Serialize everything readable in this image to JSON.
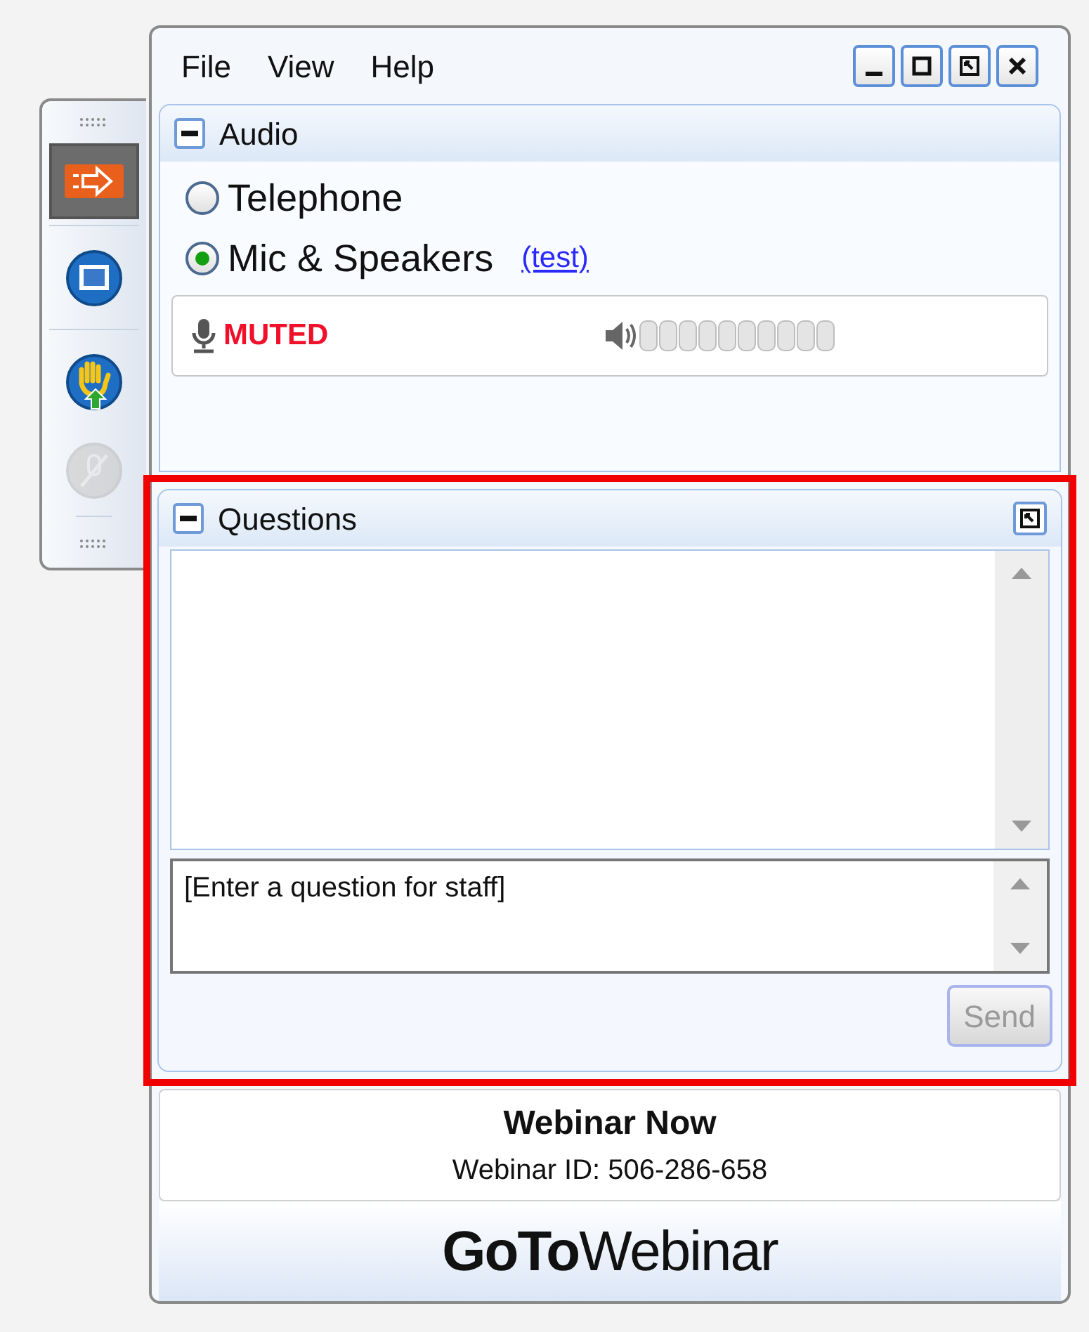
{
  "menu": [
    "File",
    "View",
    "Help"
  ],
  "window_controls": [
    {
      "kind": "minimize"
    },
    {
      "kind": "maximize"
    },
    {
      "kind": "popout"
    },
    {
      "kind": "close"
    }
  ],
  "side_toolbar": [
    {
      "kind": "arrow",
      "selected": true,
      "disabled": false
    },
    {
      "kind": "screen",
      "selected": false,
      "disabled": false
    },
    {
      "kind": "hand",
      "selected": false,
      "disabled": false
    },
    {
      "kind": "mic-off",
      "selected": false,
      "disabled": true
    }
  ],
  "audio": {
    "title": "Audio",
    "expanded": true,
    "options": [
      {
        "label": "Telephone",
        "selected": false
      },
      {
        "label": "Mic & Speakers",
        "selected": true
      }
    ],
    "test_link": "(test)",
    "mic_status": "MUTED"
  },
  "questions": {
    "title": "Questions",
    "expanded": true,
    "highlighted": true,
    "placeholder": "[Enter a question for staff]",
    "send_button": {
      "label": "Send",
      "disabled": true
    }
  },
  "session": {
    "title": "Webinar Now",
    "id_line": "Webinar ID: 506-286-658"
  },
  "logo": "**GoTo**Webinar"
}
